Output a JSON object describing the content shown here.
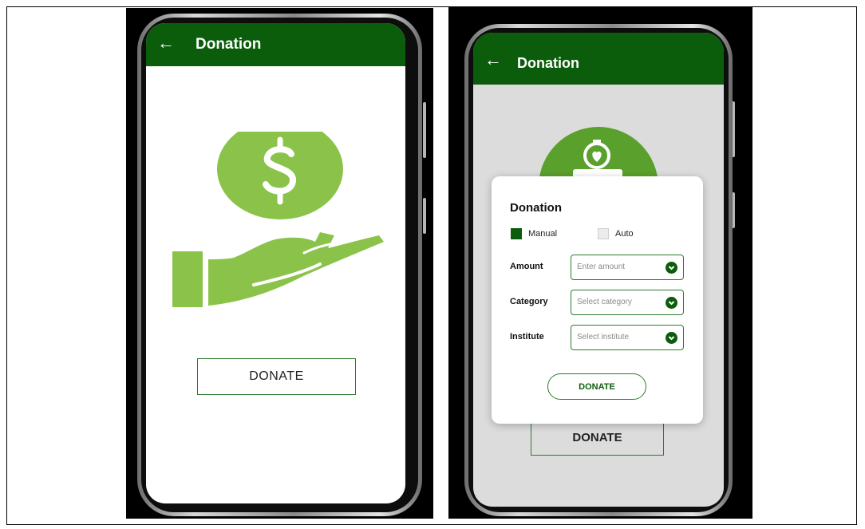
{
  "left_screen": {
    "back_arrow": "←",
    "title": "Donation",
    "illustration_icon": "hand-with-dollar-coin-icon",
    "donate_button": "DONATE"
  },
  "right_screen": {
    "back_arrow": "←",
    "title": "Donation",
    "illustration_icon": "donation-jar-heart-icon",
    "donate_button": "DONATE"
  },
  "dialog": {
    "title": "Donation",
    "options": [
      {
        "label": "Manual",
        "checked": true
      },
      {
        "label": "Auto",
        "checked": false
      }
    ],
    "fields": [
      {
        "label": "Amount",
        "placeholder": "Enter amount"
      },
      {
        "label": "Category",
        "placeholder": "Select category"
      },
      {
        "label": "Institute",
        "placeholder": "Select institute"
      }
    ],
    "donate_button": "DONATE"
  },
  "colors": {
    "primary": "#0b5d0b",
    "accent_green": "#8bc34a",
    "jar_green": "#5aa02c"
  }
}
